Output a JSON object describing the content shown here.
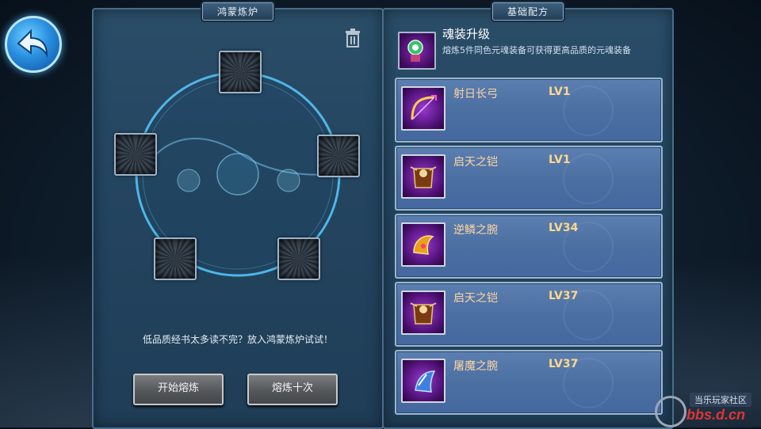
{
  "left_panel": {
    "title": "鸿蒙炼炉",
    "hint": "低品质经书太多读不完？放入鸿蒙炼炉试试！",
    "buttons": {
      "start": "开始熔炼",
      "ten": "熔炼十次"
    }
  },
  "right_panel": {
    "title": "基础配方",
    "recipe": {
      "title": "魂装升级",
      "description": "熔炼5件同色元魂装备可获得更高品质的元魂装备"
    },
    "items": [
      {
        "name": "射日长弓",
        "level": "LV1",
        "icon": "bow-icon"
      },
      {
        "name": "启天之铠",
        "level": "LV1",
        "icon": "armor-icon"
      },
      {
        "name": "逆鳞之腕",
        "level": "LV34",
        "icon": "bracer-icon"
      },
      {
        "name": "启天之铠",
        "level": "LV37",
        "icon": "armor-icon"
      },
      {
        "name": "屠魔之腕",
        "level": "LV37",
        "icon": "bracer-icon"
      }
    ]
  },
  "watermark": {
    "top": "当乐玩家社区",
    "bottom": "bbs.d.cn"
  },
  "colors": {
    "accent": "#2a8fe0",
    "level": "#ffd88a",
    "item_bg": "#5c7fb1"
  }
}
